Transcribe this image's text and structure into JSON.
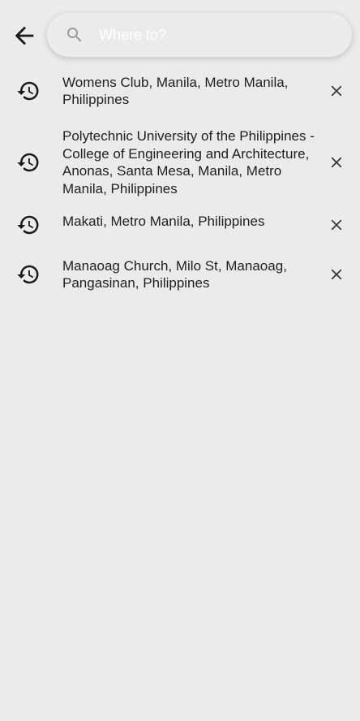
{
  "header": {
    "back_icon": "arrow-left-icon",
    "search": {
      "icon": "search-icon",
      "placeholder": "Where to?",
      "value": ""
    }
  },
  "recent_searches": [
    {
      "icon": "history-icon",
      "label": "Womens Club, Manila, Metro Manila, Philippines",
      "remove_icon": "close-icon"
    },
    {
      "icon": "history-icon",
      "label": "Polytechnic University of the Philippines - College of Engineering and Architecture, Anonas, Santa Mesa, Manila, Metro Manila, Philippines",
      "remove_icon": "close-icon"
    },
    {
      "icon": "history-icon",
      "label": "Makati, Metro Manila, Philippines",
      "remove_icon": "close-icon"
    },
    {
      "icon": "history-icon",
      "label": "Manaoag Church, Milo St, Manaoag, Pangasinan, Philippines",
      "remove_icon": "close-icon"
    }
  ],
  "colors": {
    "background": "#ebebeb",
    "text": "#1f1f1f",
    "icon": "#333333",
    "placeholder": "#ffffff"
  }
}
